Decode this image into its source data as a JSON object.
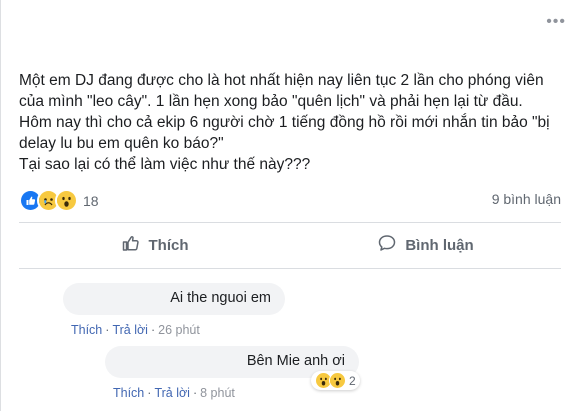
{
  "post": {
    "more_label": "•••",
    "lines": [
      "Một em DJ đang được cho là hot nhất hiện nay liên tục 2 lần cho phóng viên",
      "của mình \"leo cây\". 1 lần hẹn xong bảo \"quên lịch\" và phải hẹn lại từ đầu.",
      "Hôm nay thì cho cả ekip 6 người chờ 1 tiếng đồng hồ rồi mới nhắn tin bảo \"bị",
      "delay lu bu em quên ko báo?\"",
      "Tại sao lại có thể làm việc như thế này???"
    ],
    "reactions": {
      "icons": [
        "like-icon",
        "sad-icon",
        "wow-icon"
      ],
      "count": "18"
    },
    "comment_count": "9 bình luận"
  },
  "actions": {
    "like_label": "Thích",
    "comment_label": "Bình luận"
  },
  "comments": [
    {
      "text": "Ai the nguoi em",
      "like_label": "Thích",
      "reply_label": "Trả lời",
      "time": "26 phút"
    },
    {
      "text": "Bên Mie anh ơi",
      "like_label": "Thích",
      "reply_label": "Trả lời",
      "time": "8 phút",
      "reactions": {
        "icons": [
          "wow-icon",
          "wow-icon"
        ],
        "count": "2"
      }
    }
  ],
  "colors": {
    "link": "#4267b2",
    "like_blue": "#1877f2",
    "react_yellow": "#f7c940",
    "text_secondary": "#606770"
  }
}
